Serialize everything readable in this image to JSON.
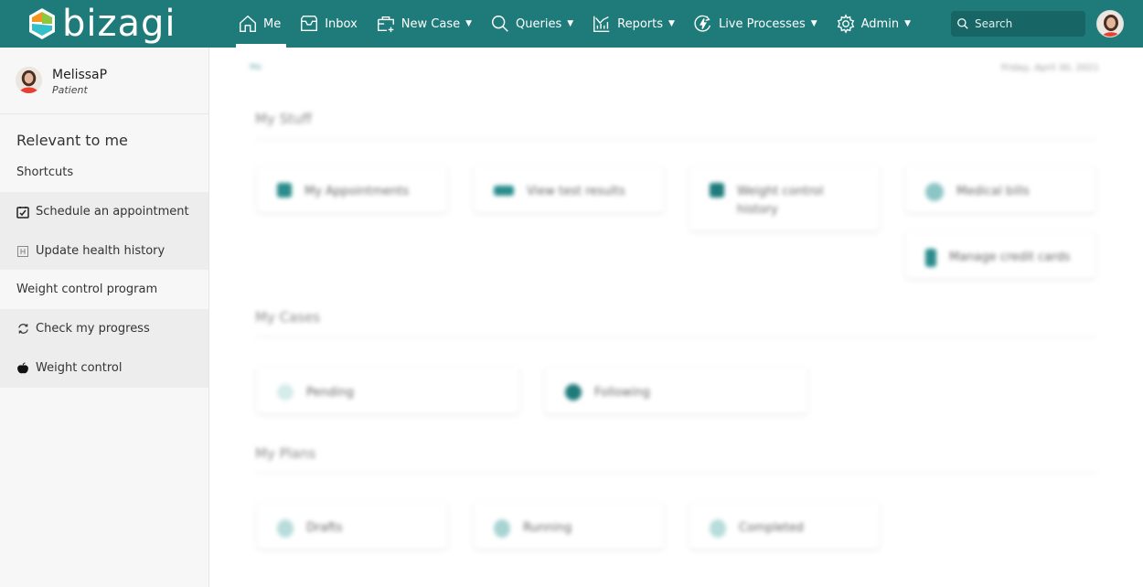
{
  "app": {
    "brand": "bizagi",
    "colors": {
      "header": "#1f7a7a",
      "accent": "#2a8c8c",
      "sidebar_bg": "#f7f7f7",
      "sidebar_item_bg": "#ededed"
    }
  },
  "header": {
    "nav": [
      {
        "label": "Me",
        "icon": "home-icon",
        "active": true,
        "dropdown": false
      },
      {
        "label": "Inbox",
        "icon": "inbox-icon",
        "active": false,
        "dropdown": false
      },
      {
        "label": "New Case",
        "icon": "new-case-icon",
        "active": false,
        "dropdown": true
      },
      {
        "label": "Queries",
        "icon": "search-icon",
        "active": false,
        "dropdown": true
      },
      {
        "label": "Reports",
        "icon": "chart-icon",
        "active": false,
        "dropdown": true
      },
      {
        "label": "Live Processes",
        "icon": "lightning-icon",
        "active": false,
        "dropdown": true
      },
      {
        "label": "Admin",
        "icon": "gear-icon",
        "active": false,
        "dropdown": true
      }
    ],
    "search": {
      "placeholder": "Search",
      "value": ""
    }
  },
  "sidebar": {
    "user": {
      "name": "MelissaP",
      "role": "Patient"
    },
    "title": "Relevant to me",
    "sections": [
      {
        "label": "Shortcuts",
        "items": [
          {
            "label": "Schedule an appointment",
            "icon": "calendar-check-icon"
          },
          {
            "label": "Update health history",
            "icon": "health-history-icon"
          }
        ]
      },
      {
        "label": "Weight control program",
        "items": [
          {
            "label": "Check my progress",
            "icon": "refresh-icon"
          },
          {
            "label": "Weight control",
            "icon": "apple-icon"
          }
        ]
      }
    ]
  },
  "main": {
    "breadcrumb": "Me",
    "date": "Friday, April 30, 2021",
    "sections": [
      {
        "title": "My Stuff",
        "tiles": [
          {
            "label": "My Appointments",
            "icon": "document-icon"
          },
          {
            "label": "View test results",
            "icon": "results-icon"
          },
          {
            "label": "Weight control history",
            "icon": "history-icon"
          },
          {
            "label": "Medical bills",
            "icon": "bill-icon"
          },
          {
            "label": "Manage credit cards",
            "icon": "dollar-icon"
          }
        ]
      },
      {
        "title": "My Cases",
        "tiles": [
          {
            "label": "Pending",
            "icon": "pending-icon"
          },
          {
            "label": "Following",
            "icon": "star-icon"
          }
        ]
      },
      {
        "title": "My Plans",
        "tiles": [
          {
            "label": "Drafts",
            "icon": "drafts-icon"
          },
          {
            "label": "Running",
            "icon": "running-icon"
          },
          {
            "label": "Completed",
            "icon": "completed-icon"
          }
        ]
      }
    ]
  }
}
